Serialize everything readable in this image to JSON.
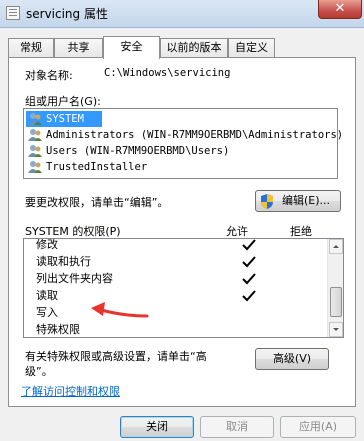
{
  "window": {
    "title": "servicing 属性",
    "close_glyph": "✕"
  },
  "tabs": [
    {
      "label": "常规"
    },
    {
      "label": "共享"
    },
    {
      "label": "安全"
    },
    {
      "label": "以前的版本"
    },
    {
      "label": "自定义"
    }
  ],
  "object": {
    "label": "对象名称:",
    "value": "C:\\Windows\\servicing"
  },
  "groups": {
    "label": "组或用户名(G):",
    "items": [
      {
        "name": "SYSTEM",
        "icon": "user-group-icon",
        "selected": true
      },
      {
        "name": "Administrators (WIN-R7MM9OERBMD\\Administrators)",
        "icon": "user-group-icon",
        "selected": false
      },
      {
        "name": "Users (WIN-R7MM9OERBMD\\Users)",
        "icon": "user-group-icon",
        "selected": false
      },
      {
        "name": "TrustedInstaller",
        "icon": "user-group-icon",
        "selected": false
      }
    ]
  },
  "change_hint": "要更改权限，请单击“编辑”。",
  "edit_button": {
    "label": "编辑(E)...",
    "icon": "uac-shield-icon"
  },
  "permissions": {
    "title": "SYSTEM 的权限(P)",
    "allow_header": "允许",
    "deny_header": "拒绝",
    "rows": [
      {
        "name": "修改",
        "allow": true
      },
      {
        "name": "读取和执行",
        "allow": true
      },
      {
        "name": "列出文件夹内容",
        "allow": true
      },
      {
        "name": "读取",
        "allow": true
      },
      {
        "name": "写入",
        "allow": false
      },
      {
        "name": "特殊权限",
        "allow": false
      }
    ]
  },
  "advanced_hint": {
    "line1": "有关特殊权限或高级设置，请单击“高",
    "line2": "级”。"
  },
  "advanced_button": {
    "label": "高级(V)"
  },
  "link": {
    "label": "了解访问控制和权限"
  },
  "buttons": {
    "close": "关闭",
    "cancel": "取消",
    "apply": "应用(A)"
  },
  "annotation": {
    "arrow_color": "#e8342c",
    "points_to": "写入"
  }
}
